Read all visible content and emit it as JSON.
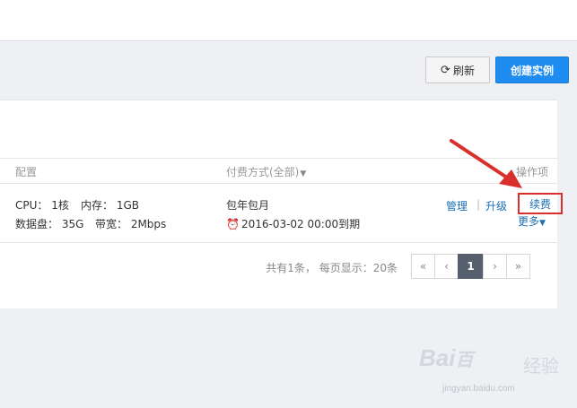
{
  "toolbar": {
    "refresh_icon": "refresh-icon",
    "refresh_label": "刷新",
    "create_label": "创建实例",
    "create_color": "#1e8cf0"
  },
  "table": {
    "headers": {
      "config": "配置",
      "billing": "付费方式(全部)",
      "operations": "操作项"
    },
    "row": {
      "cpu": "CPU： 1核",
      "memory": "内存： 1GB",
      "disk": "数据盘： 35G",
      "bandwidth": "带宽： 2Mbps",
      "billing_mode": "包年包月",
      "expiry": "2016-03-02 00:00到期",
      "ops": {
        "manage": "管理",
        "separator": "|",
        "upgrade": "升级",
        "renew": "续费",
        "more": "更多"
      }
    }
  },
  "pagination": {
    "info": "共有1条， 每页显示：20条",
    "first": "«",
    "prev": "‹",
    "current": "1",
    "next": "›",
    "last": "»"
  },
  "annotation": {
    "highlight_color": "#d9302c"
  },
  "watermark": {
    "brand": "Bai",
    "brand_suffix": "百",
    "label": "经验",
    "url": "jingyan.baidu.com"
  }
}
